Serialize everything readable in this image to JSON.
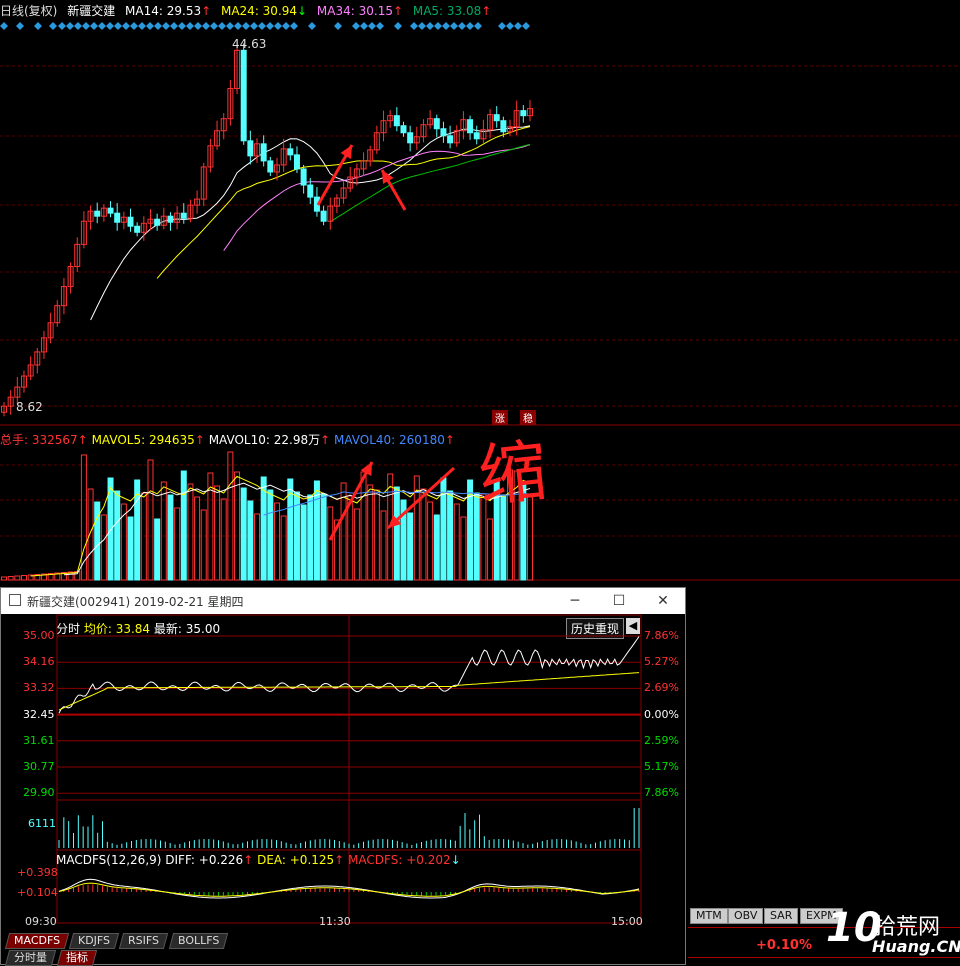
{
  "kline_header": {
    "period": "日线(复权)",
    "stock": "新疆交建",
    "ma14": "MA14: 29.53",
    "ma24": "MA24: 30.94",
    "ma34": "MA34: 30.15",
    "ma5": "MA5: 33.08",
    "up_arrow": "↑",
    "down_arrow": "↓"
  },
  "kline_labels": {
    "high": "44.63",
    "low": "8.62"
  },
  "vol_header": {
    "total": "总手: 332567",
    "mavol5": "MAVOL5: 294635",
    "mavol10": "MAVOL10: 22.98万",
    "mavol40": "MAVOL40: 260180",
    "up_arrow": "↑"
  },
  "badges": {
    "zhang": "涨",
    "wen": "稳"
  },
  "annotation": {
    "text": "缩"
  },
  "popup": {
    "title": "新疆交建(002941) 2019-02-21 星期四",
    "minimize": "─",
    "maximize": "☐",
    "close": "✕",
    "info_label": "分时",
    "avg_price": "均价: 33.84",
    "latest": "最新: 35.00",
    "history_button": "历史重现",
    "left_prices": [
      "35.00",
      "34.16",
      "33.32",
      "32.45",
      "31.61",
      "30.77",
      "29.90"
    ],
    "right_pcts": [
      "7.86%",
      "5.27%",
      "2.69%",
      "0.00%",
      "2.59%",
      "5.17%",
      "7.86%"
    ],
    "vol_label": "6111",
    "macd_header": "MACDFS(12,26,9) DIFF: +0.226",
    "dea": "DEA: +0.125",
    "macdfs": "MACDFS: +0.202",
    "macd_top": "+0.398",
    "macd_mid": "+0.104",
    "time_start": "09:30",
    "time_mid": "11:30",
    "time_end": "15:00"
  },
  "indicator_tabs": [
    "MACDFS",
    "KDJFS",
    "RSIFS",
    "BOLLFS"
  ],
  "bottom_tabs": [
    "分时量",
    "指标"
  ],
  "right_tabs": [
    "MTM",
    "OBV",
    "SAR",
    "EXPM"
  ],
  "right_value": "+0.10%",
  "watermark": {
    "number": "10",
    "site": "拾荒网",
    "url": "Huang.CN"
  },
  "colors": {
    "up": "#ff3232",
    "down": "#54ffff",
    "ma14": "#ffffff",
    "ma24": "#ffff00",
    "ma34": "#ff80ff",
    "ma5": "#00c000"
  }
}
